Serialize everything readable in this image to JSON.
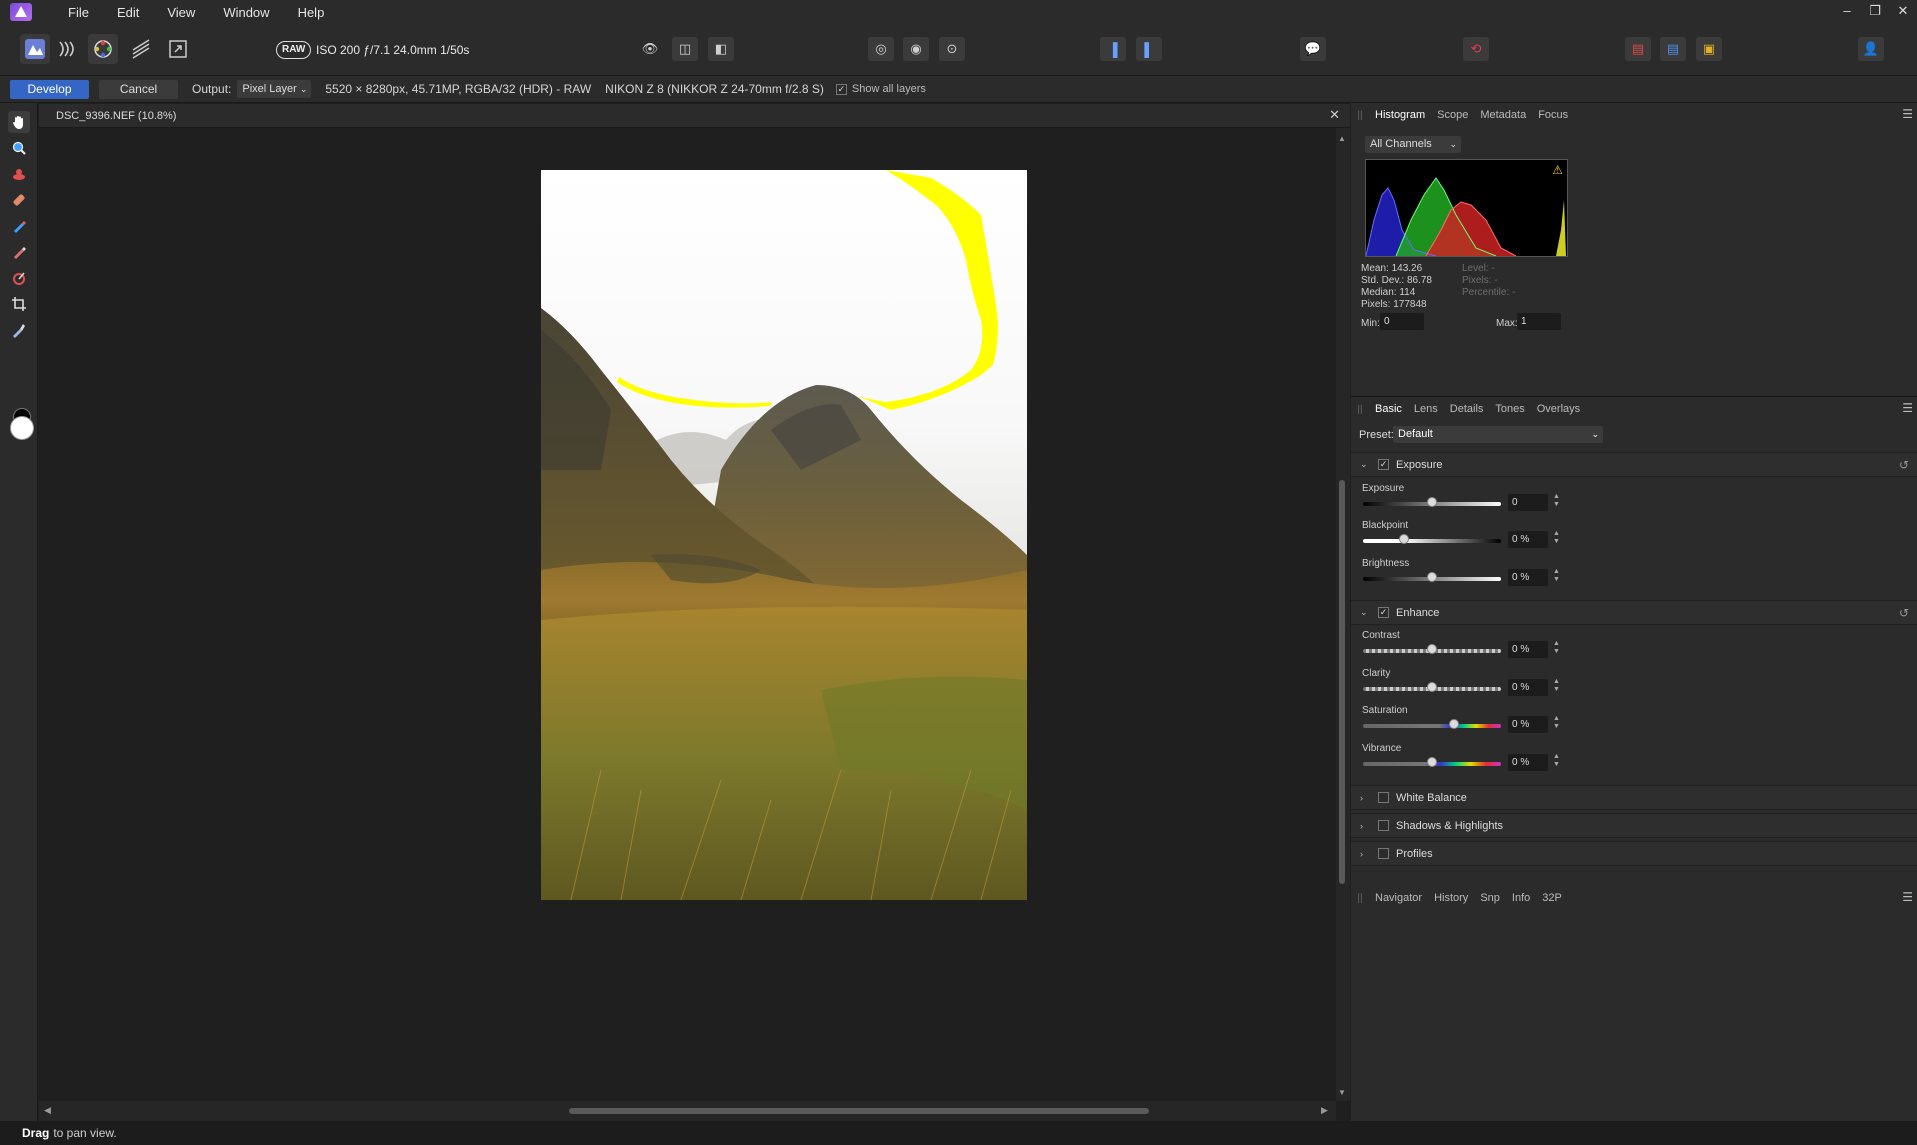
{
  "app": {
    "menu": [
      "File",
      "Edit",
      "View",
      "Window",
      "Help"
    ],
    "window_controls": [
      "–",
      "❐",
      "✕"
    ]
  },
  "toolbar": {
    "raw_badge": "RAW",
    "raw_info": "ISO 200 ƒ/7.1 24.0mm 1/50s"
  },
  "context": {
    "develop": "Develop",
    "cancel": "Cancel",
    "output_label": "Output:",
    "output_value": "Pixel Layer",
    "image_info": "5520 × 8280px, 45.71MP, RGBA/32 (HDR) - RAW",
    "camera_info": "NIKON Z 8 (NIKKOR Z 24-70mm f/2.8 S)",
    "show_all_layers": "Show all layers"
  },
  "document": {
    "title": "DSC_9396.NEF (10.8%)",
    "close": "✕"
  },
  "status": {
    "bold": "Drag",
    "text": "to pan view."
  },
  "histogram_panel": {
    "tabs": [
      "Histogram",
      "Scope",
      "Metadata",
      "Focus"
    ],
    "channel": "All Channels",
    "stats": {
      "mean": "Mean: 143.26",
      "std": "Std. Dev.: 86.78",
      "median": "Median: 114",
      "pixels": "Pixels: 177848",
      "level": "Level: -",
      "pixels2": "Pixels: -",
      "percentile": "Percentile: -"
    },
    "min_label": "Min:",
    "min_value": "0",
    "max_label": "Max:",
    "max_value": "1",
    "warning_icon": "warning-icon"
  },
  "develop_panel": {
    "tabs": [
      "Basic",
      "Lens",
      "Details",
      "Tones",
      "Overlays"
    ],
    "preset_label": "Preset:",
    "preset_value": "Default",
    "exposure_group": {
      "title": "Exposure",
      "sliders": [
        {
          "label": "Exposure",
          "value": "0",
          "level": 0.5
        },
        {
          "label": "Blackpoint",
          "value": "0 %",
          "level": 0.3
        },
        {
          "label": "Brightness",
          "value": "0 %",
          "level": 0.5
        }
      ]
    },
    "enhance_group": {
      "title": "Enhance",
      "sliders": [
        {
          "label": "Contrast",
          "value": "0 %",
          "level": 0.5
        },
        {
          "label": "Clarity",
          "value": "0 %",
          "level": 0.5
        },
        {
          "label": "Saturation",
          "value": "0 %",
          "level": 0.66
        },
        {
          "label": "Vibrance",
          "value": "0 %",
          "level": 0.5
        }
      ]
    },
    "collapsed_groups": [
      "White Balance",
      "Shadows & Highlights",
      "Profiles"
    ]
  },
  "nav_panel": {
    "tabs": [
      "Navigator",
      "History",
      "Snp",
      "Info",
      "32P"
    ]
  },
  "colors": {
    "accent": "#3566c5",
    "clipping_overlay": "#ffff00"
  }
}
